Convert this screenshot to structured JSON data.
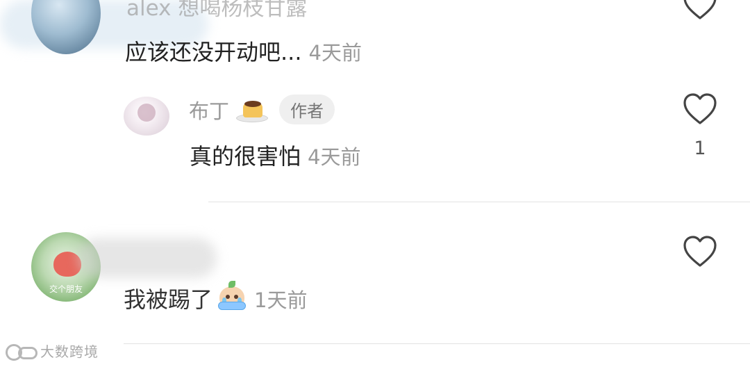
{
  "comments": [
    {
      "author": "alex 想喝杨枝甘露",
      "text": "应该还没开动吧...",
      "time": "4天前"
    },
    {
      "author": "布丁",
      "author_badge": "作者",
      "author_emoji": "pudding-emoji",
      "text": "真的很害怕",
      "time": "4天前",
      "like_count": "1"
    },
    {
      "avatar_text": "交个朋友",
      "text": "我被踢了",
      "text_emoji": "crying-emoji",
      "time": "1天前"
    }
  ],
  "watermark": {
    "text": "大数跨境"
  },
  "icons": {
    "like": "heart-outline-icon"
  },
  "colors": {
    "text": "#222222",
    "meta": "#9a9a9a",
    "badge_bg": "#efefef",
    "divider": "#e3e3e3"
  }
}
